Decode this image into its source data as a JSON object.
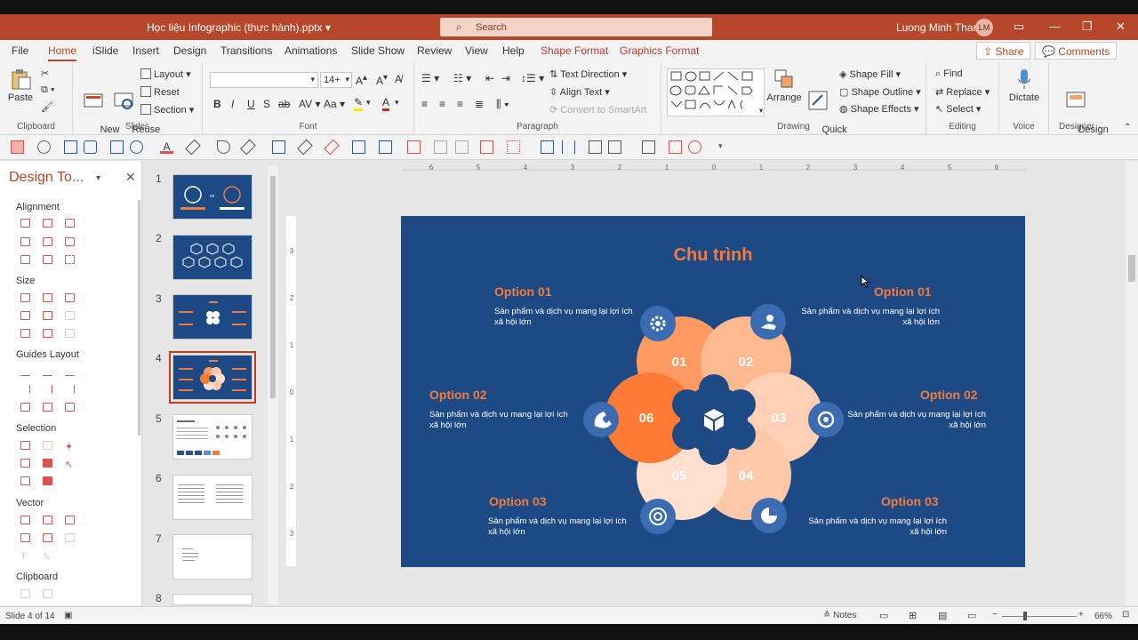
{
  "window": {
    "title": "Học liệu Infographic (thực hành).pptx",
    "search_placeholder": "Search",
    "user_name": "Luong Minh Thanh",
    "user_initials": "LM"
  },
  "tabs": [
    "File",
    "Home",
    "iSlide",
    "Insert",
    "Design",
    "Transitions",
    "Animations",
    "Slide Show",
    "Review",
    "View",
    "Help",
    "Shape Format",
    "Graphics Format"
  ],
  "share_label": "Share",
  "comments_label": "Comments",
  "ribbon": {
    "clipboard": {
      "label": "Clipboard",
      "paste": "Paste"
    },
    "slides": {
      "label": "Slides",
      "new_slide": "New\nSlide",
      "reuse_slides": "Reuse\nSlides",
      "layout": "Layout",
      "reset": "Reset",
      "section": "Section"
    },
    "font": {
      "label": "Font",
      "font_name": "",
      "font_size": "14+"
    },
    "paragraph": {
      "label": "Paragraph",
      "text_direction": "Text Direction",
      "align_text": "Align Text",
      "convert_smartart": "Convert to SmartArt"
    },
    "drawing": {
      "label": "Drawing",
      "arrange": "Arrange",
      "quick_styles": "Quick\nStyles",
      "shape_fill": "Shape Fill",
      "shape_outline": "Shape Outline",
      "shape_effects": "Shape Effects"
    },
    "editing": {
      "label": "Editing",
      "find": "Find",
      "replace": "Replace",
      "select": "Select"
    },
    "voice": {
      "label": "Voice",
      "dictate": "Dictate"
    },
    "designer": {
      "label": "Designer",
      "design_ideas": "Design\nIdeas"
    }
  },
  "pane": {
    "title": "Design To...",
    "sections": [
      "Alignment",
      "Size",
      "Guides Layout",
      "Selection",
      "Vector",
      "Clipboard"
    ]
  },
  "thumbnails": [
    "1",
    "2",
    "3",
    "4",
    "5",
    "6",
    "7",
    "8"
  ],
  "selected_slide": 4,
  "statusbar": {
    "slide_info": "Slide 4 of 14",
    "notes": "Notes",
    "zoom": "66%"
  },
  "slide": {
    "title": "Chu trình",
    "options": [
      {
        "title": "Option 01",
        "desc": "Sản phẩm và dịch vụ mang lại lợi ích xã hội lớn"
      },
      {
        "title": "Option 01",
        "desc": "Sản phẩm và dịch vụ mang lại lợi ích xã hội lớn"
      },
      {
        "title": "Option 02",
        "desc": "Sản phẩm và dịch vụ mang lại lợi ích xã hội lớn"
      },
      {
        "title": "Option 02",
        "desc": "Sản phẩm và dịch vụ mang lại lợi ích xã hội lớn"
      },
      {
        "title": "Option 03",
        "desc": "Sản phẩm và dịch vụ mang lại lợi ích xã hội lớn"
      },
      {
        "title": "Option 03",
        "desc": "Sản phẩm và dịch vụ mang lại lợi ích xã hội lớn"
      }
    ],
    "petals": [
      "01",
      "02",
      "03",
      "04",
      "05",
      "06"
    ],
    "colors": {
      "background": "#1d4a84",
      "accent": "#f07b3f",
      "petal_dark": "#ff7a35",
      "petal_mid": "#ff9a62",
      "petal_light": "#ffc8a8",
      "petal_pale": "#ffe0cf",
      "icon_circle": "#3b6bb0"
    }
  }
}
